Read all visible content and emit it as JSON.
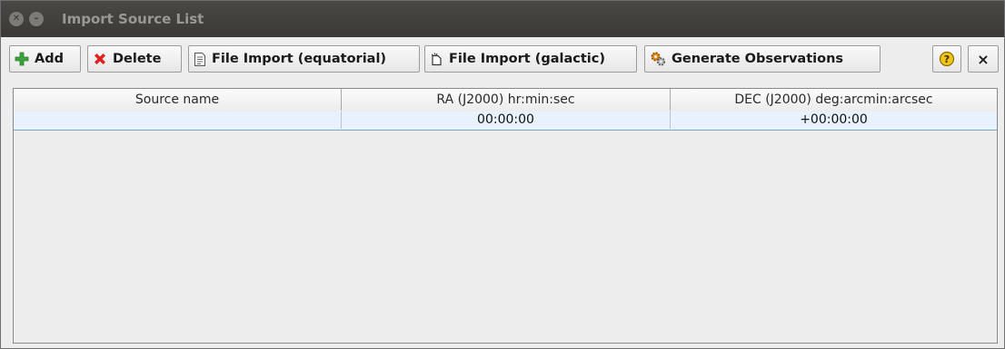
{
  "window": {
    "title": "Import Source List"
  },
  "toolbar": {
    "add_label": "Add",
    "delete_label": "Delete",
    "file_import_equatorial_label": "File Import (equatorial)",
    "file_import_galactic_label": "File Import (galactic)",
    "generate_observations_label": "Generate Observations",
    "help_glyph": "?",
    "close_glyph": "×"
  },
  "table": {
    "columns": [
      "Source name",
      "RA (J2000) hr:min:sec",
      "DEC (J2000) deg:arcmin:arcsec"
    ],
    "rows": [
      [
        "",
        "00:00:00",
        "+00:00:00"
      ]
    ]
  },
  "icons": {
    "add": "plus-icon",
    "delete": "x-mark-icon",
    "file_equatorial": "document-icon",
    "file_galactic": "new-document-icon",
    "generate": "gears-icon",
    "help": "help-icon",
    "close": "close-icon"
  },
  "colors": {
    "titlebar": "#3d3b38",
    "add_icon": "#3aa33a",
    "delete_icon": "#e02020",
    "help_icon": "#f0c419",
    "selected_row": "#e8f2fe"
  }
}
